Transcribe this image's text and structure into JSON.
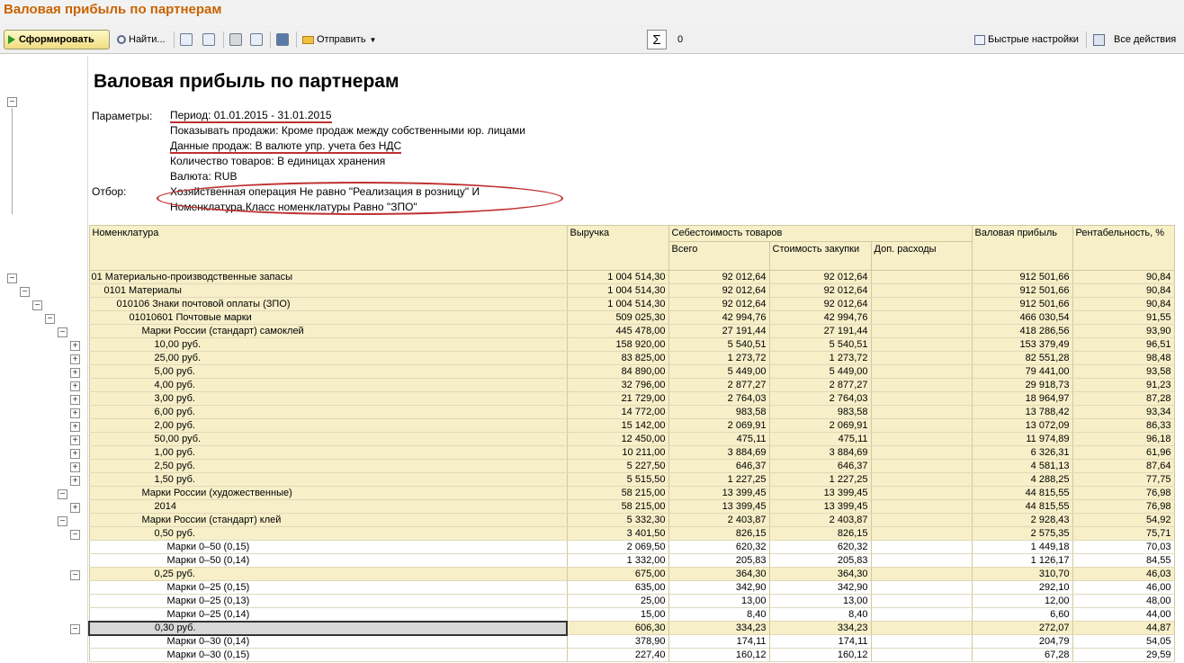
{
  "window": {
    "title": "Валовая прибыль по партнерам"
  },
  "toolbar": {
    "form_label": "Сформировать",
    "find_label": "Найти...",
    "send_label": "Отправить",
    "sum_value": "0",
    "quick_settings": "Быстрые настройки",
    "all_actions": "Все действия"
  },
  "report": {
    "title": "Валовая прибыль по партнерам",
    "params_label": "Параметры:",
    "params": [
      "Период: 01.01.2015 - 31.01.2015",
      "Показывать продажи: Кроме продаж между собственными юр. лицами",
      "Данные продаж: В валюте упр. учета без НДС",
      "Количество товаров: В единицах хранения",
      "Валюта: RUB"
    ],
    "filter_label": "Отбор:",
    "filter": [
      "Хозяйственная операция Не равно \"Реализация в розницу\" И",
      "Номенклатура.Класс номенклатуры Равно \"ЗПО\""
    ]
  },
  "table": {
    "headers": {
      "name": "Номенклатура",
      "revenue": "Выручка",
      "cost_group": "Себестоимость товаров",
      "cost_total": "Всего",
      "cost_purchase": "Стоимость закупки",
      "cost_extra": "Доп. расходы",
      "gross_profit": "Валовая прибыль",
      "profitability": "Рентабельность, %"
    },
    "rows": [
      {
        "name": "01 Материально-производственные запасы",
        "revenue": "1 004 514,30",
        "total": "92 012,64",
        "purchase": "92 012,64",
        "extra": "",
        "profit": "912 501,66",
        "pct": "90,84"
      },
      {
        "name": "0101 Материалы",
        "revenue": "1 004 514,30",
        "total": "92 012,64",
        "purchase": "92 012,64",
        "extra": "",
        "profit": "912 501,66",
        "pct": "90,84"
      },
      {
        "name": "010106 Знаки почтовой оплаты (ЗПО)",
        "revenue": "1 004 514,30",
        "total": "92 012,64",
        "purchase": "92 012,64",
        "extra": "",
        "profit": "912 501,66",
        "pct": "90,84"
      },
      {
        "name": "01010601 Почтовые марки",
        "revenue": "509 025,30",
        "total": "42 994,76",
        "purchase": "42 994,76",
        "extra": "",
        "profit": "466 030,54",
        "pct": "91,55"
      },
      {
        "name": "Марки России (стандарт) самоклей",
        "revenue": "445 478,00",
        "total": "27 191,44",
        "purchase": "27 191,44",
        "extra": "",
        "profit": "418 286,56",
        "pct": "93,90"
      },
      {
        "name": "10,00 руб.",
        "revenue": "158 920,00",
        "total": "5 540,51",
        "purchase": "5 540,51",
        "extra": "",
        "profit": "153 379,49",
        "pct": "96,51"
      },
      {
        "name": "25,00 руб.",
        "revenue": "83 825,00",
        "total": "1 273,72",
        "purchase": "1 273,72",
        "extra": "",
        "profit": "82 551,28",
        "pct": "98,48"
      },
      {
        "name": "5,00 руб.",
        "revenue": "84 890,00",
        "total": "5 449,00",
        "purchase": "5 449,00",
        "extra": "",
        "profit": "79 441,00",
        "pct": "93,58"
      },
      {
        "name": "4,00 руб.",
        "revenue": "32 796,00",
        "total": "2 877,27",
        "purchase": "2 877,27",
        "extra": "",
        "profit": "29 918,73",
        "pct": "91,23"
      },
      {
        "name": "3,00 руб.",
        "revenue": "21 729,00",
        "total": "2 764,03",
        "purchase": "2 764,03",
        "extra": "",
        "profit": "18 964,97",
        "pct": "87,28"
      },
      {
        "name": "6,00 руб.",
        "revenue": "14 772,00",
        "total": "983,58",
        "purchase": "983,58",
        "extra": "",
        "profit": "13 788,42",
        "pct": "93,34"
      },
      {
        "name": "2,00 руб.",
        "revenue": "15 142,00",
        "total": "2 069,91",
        "purchase": "2 069,91",
        "extra": "",
        "profit": "13 072,09",
        "pct": "86,33"
      },
      {
        "name": "50,00 руб.",
        "revenue": "12 450,00",
        "total": "475,11",
        "purchase": "475,11",
        "extra": "",
        "profit": "11 974,89",
        "pct": "96,18"
      },
      {
        "name": "1,00 руб.",
        "revenue": "10 211,00",
        "total": "3 884,69",
        "purchase": "3 884,69",
        "extra": "",
        "profit": "6 326,31",
        "pct": "61,96"
      },
      {
        "name": "2,50 руб.",
        "revenue": "5 227,50",
        "total": "646,37",
        "purchase": "646,37",
        "extra": "",
        "profit": "4 581,13",
        "pct": "87,64"
      },
      {
        "name": "1,50 руб.",
        "revenue": "5 515,50",
        "total": "1 227,25",
        "purchase": "1 227,25",
        "extra": "",
        "profit": "4 288,25",
        "pct": "77,75"
      },
      {
        "name": "Марки России (художественные)",
        "revenue": "58 215,00",
        "total": "13 399,45",
        "purchase": "13 399,45",
        "extra": "",
        "profit": "44 815,55",
        "pct": "76,98"
      },
      {
        "name": "2014",
        "revenue": "58 215,00",
        "total": "13 399,45",
        "purchase": "13 399,45",
        "extra": "",
        "profit": "44 815,55",
        "pct": "76,98"
      },
      {
        "name": "Марки России (стандарт) клей",
        "revenue": "5 332,30",
        "total": "2 403,87",
        "purchase": "2 403,87",
        "extra": "",
        "profit": "2 928,43",
        "pct": "54,92"
      },
      {
        "name": "0,50 руб.",
        "revenue": "3 401,50",
        "total": "826,15",
        "purchase": "826,15",
        "extra": "",
        "profit": "2 575,35",
        "pct": "75,71"
      },
      {
        "name": "Марки 0–50 (0,15)",
        "revenue": "2 069,50",
        "total": "620,32",
        "purchase": "620,32",
        "extra": "",
        "profit": "1 449,18",
        "pct": "70,03"
      },
      {
        "name": "Марки 0–50 (0,14)",
        "revenue": "1 332,00",
        "total": "205,83",
        "purchase": "205,83",
        "extra": "",
        "profit": "1 126,17",
        "pct": "84,55"
      },
      {
        "name": "0,25 руб.",
        "revenue": "675,00",
        "total": "364,30",
        "purchase": "364,30",
        "extra": "",
        "profit": "310,70",
        "pct": "46,03"
      },
      {
        "name": "Марки 0–25 (0,15)",
        "revenue": "635,00",
        "total": "342,90",
        "purchase": "342,90",
        "extra": "",
        "profit": "292,10",
        "pct": "46,00"
      },
      {
        "name": "Марки 0–25 (0,13)",
        "revenue": "25,00",
        "total": "13,00",
        "purchase": "13,00",
        "extra": "",
        "profit": "12,00",
        "pct": "48,00"
      },
      {
        "name": "Марки 0–25 (0,14)",
        "revenue": "15,00",
        "total": "8,40",
        "purchase": "8,40",
        "extra": "",
        "profit": "6,60",
        "pct": "44,00"
      },
      {
        "name": "0,30 руб.",
        "revenue": "606,30",
        "total": "334,23",
        "purchase": "334,23",
        "extra": "",
        "profit": "272,07",
        "pct": "44,87"
      },
      {
        "name": "Марки 0–30 (0,14)",
        "revenue": "378,90",
        "total": "174,11",
        "purchase": "174,11",
        "extra": "",
        "profit": "204,79",
        "pct": "54,05"
      },
      {
        "name": "Марки 0–30 (0,15)",
        "revenue": "227,40",
        "total": "160,12",
        "purchase": "160,12",
        "extra": "",
        "profit": "67,28",
        "pct": "29,59"
      }
    ]
  }
}
